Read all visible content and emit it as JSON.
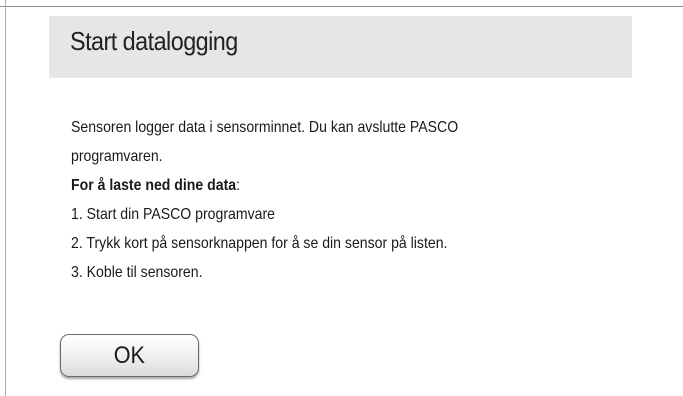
{
  "dialog": {
    "title": "Start datalogging",
    "intro": "Sensoren logger data i sensorminnet. Du kan avslutte PASCO programvaren.",
    "download_heading": "For å laste ned dine data",
    "download_heading_colon": ":",
    "steps": [
      "1. Start din PASCO programvare",
      "2. Trykk kort på sensorknappen for å se din sensor på listen.",
      "3. Koble til sensoren."
    ],
    "ok_label": "OK"
  }
}
